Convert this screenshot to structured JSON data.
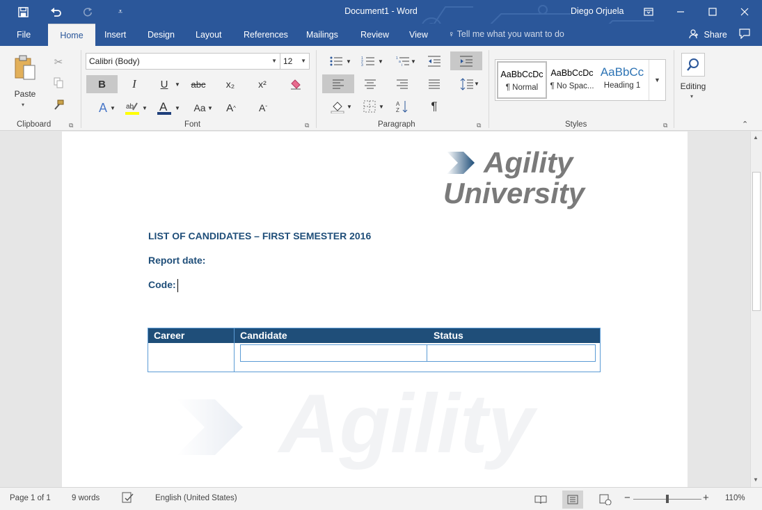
{
  "window": {
    "title": "Document1  -  Word",
    "user": "Diego Orjuela",
    "qat": {
      "save_icon": "save-icon",
      "undo_icon": "undo-icon",
      "redo_icon": "redo-icon",
      "customize_icon": "customize-qat-icon"
    },
    "controls": {
      "ribbon_display": "▭",
      "minimize": "—",
      "maximize": "☐",
      "close": "✕"
    }
  },
  "tabs": {
    "items": [
      "File",
      "Home",
      "Insert",
      "Design",
      "Layout",
      "References",
      "Mailings",
      "Review",
      "View"
    ],
    "active": "Home",
    "tell_me": "Tell me what you want to do",
    "share": "Share"
  },
  "ribbon": {
    "clipboard": {
      "label": "Clipboard",
      "paste": "Paste"
    },
    "font": {
      "label": "Font",
      "font_name": "Calibri (Body)",
      "font_size": "12",
      "bold": "B",
      "italic": "I",
      "underline": "U",
      "strike": "abc",
      "subscript": "x₂",
      "superscript": "x²",
      "change_case": "Aa",
      "grow": "A",
      "shrink": "A"
    },
    "paragraph": {
      "label": "Paragraph",
      "pilcrow": "¶"
    },
    "styles": {
      "label": "Styles",
      "items": [
        {
          "sample": "AaBbCcDc",
          "name": "¶ Normal"
        },
        {
          "sample": "AaBbCcDc",
          "name": "¶ No Spac..."
        },
        {
          "sample": "AaBbCc",
          "name": "Heading 1"
        }
      ]
    },
    "editing": {
      "label": "Editing"
    }
  },
  "document": {
    "logo_line1": "Agility",
    "logo_line2": "University",
    "title": "LIST OF CANDIDATES – FIRST SEMESTER 2016",
    "report_date_label": "Report date:",
    "code_label": "Code:",
    "table": {
      "headers": [
        "Career",
        "Candidate",
        "Status"
      ]
    },
    "watermark": "Agility"
  },
  "status": {
    "page": "Page 1 of 1",
    "words": "9 words",
    "language": "English (United States)",
    "zoom": "110%",
    "zoom_minus": "−",
    "zoom_plus": "+"
  },
  "colors": {
    "titlebar": "#2b579a",
    "heading": "#1f4e79",
    "table_border": "#5b9bd5"
  }
}
